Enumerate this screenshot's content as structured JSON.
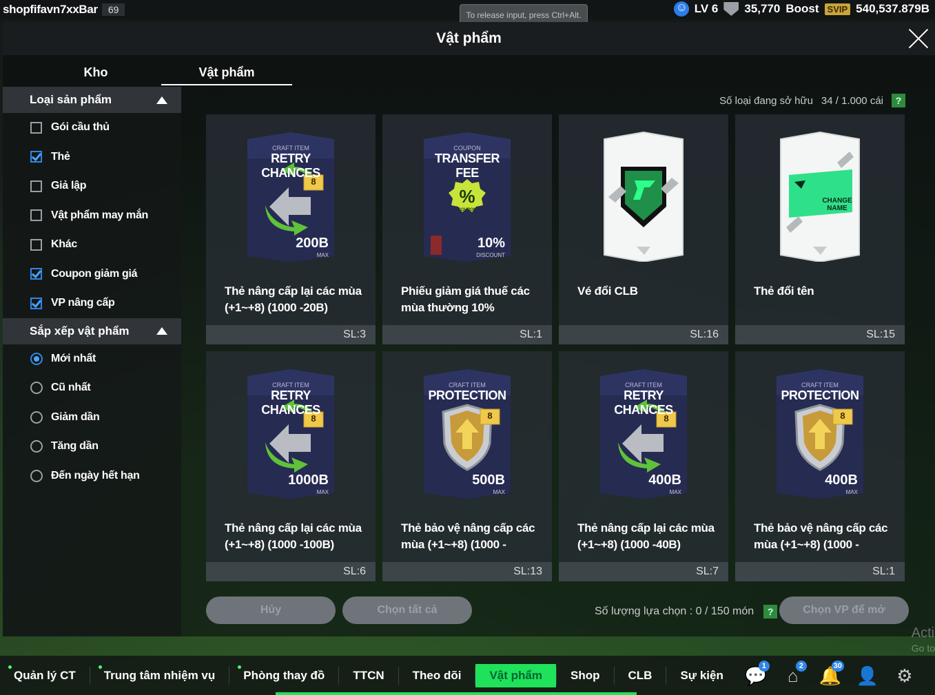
{
  "topbar": {
    "username": "shopfifavn7xxBar",
    "user_level": "69",
    "tooltip": "To release input, press Ctrl+Alt.",
    "lv": "LV 6",
    "points": "35,770",
    "boost": "Boost",
    "svip": "SVIP",
    "balance": "540,537.879B"
  },
  "window": {
    "title": "Vật phẩm"
  },
  "tabs": [
    {
      "label": "Kho"
    },
    {
      "label": "Vật phẩm"
    }
  ],
  "sidebar": {
    "category_header": "Loại sản phẩm",
    "categories": [
      {
        "label": "Gói cầu thủ",
        "checked": false
      },
      {
        "label": "Thẻ",
        "checked": true
      },
      {
        "label": "Giả lập",
        "checked": false
      },
      {
        "label": "Vật phẩm may mắn",
        "checked": false
      },
      {
        "label": "Khác",
        "checked": false
      },
      {
        "label": "Coupon giảm giá",
        "checked": true
      },
      {
        "label": "VP nâng cấp",
        "checked": true
      }
    ],
    "sort_header": "Sắp xếp vật phẩm",
    "sorts": [
      {
        "label": "Mới nhất",
        "selected": true
      },
      {
        "label": "Cũ nhất",
        "selected": false
      },
      {
        "label": "Giảm dần",
        "selected": false
      },
      {
        "label": "Tăng dần",
        "selected": false
      },
      {
        "label": "Đến ngày hết hạn",
        "selected": false
      }
    ]
  },
  "owned": {
    "label": "Số loại đang sở hữu",
    "value": "34 / 1.000 cái",
    "help": "?"
  },
  "items": [
    {
      "art": "retry",
      "top": "CRAFT ITEM",
      "title": "RETRY CHANCES",
      "badge": "8",
      "value": "200B",
      "sub": "MAX",
      "name": "Thẻ nâng cấp lại các mùa (+1~+8) (1000 -20B)",
      "qty": "SL:3"
    },
    {
      "art": "coupon",
      "top": "COUPON",
      "title": "TRANSFER FEE",
      "badge": "%",
      "badge_sub": "COUPON",
      "value": "10%",
      "sub": "DISCOUNT",
      "name": "Phiếu giảm giá thuế các mùa thường 10%",
      "qty": "SL:1"
    },
    {
      "art": "clb",
      "name": "Vé đổi CLB",
      "qty": "SL:16"
    },
    {
      "art": "rename",
      "card_text": "CHANGE NAME",
      "name": "Thẻ đổi tên",
      "qty": "SL:15"
    },
    {
      "art": "retry",
      "top": "CRAFT ITEM",
      "title": "RETRY CHANCES",
      "badge": "8",
      "value": "1000B",
      "sub": "MAX",
      "name": "Thẻ nâng cấp lại các mùa (+1~+8) (1000 -100B)",
      "qty": "SL:6"
    },
    {
      "art": "protect",
      "top": "CRAFT ITEM",
      "title": "PROTECTION",
      "badge": "8",
      "value": "500B",
      "sub": "MAX",
      "name": "Thẻ bảo vệ nâng cấp các mùa (+1~+8) (1000 -",
      "qty": "SL:13"
    },
    {
      "art": "retry",
      "top": "CRAFT ITEM",
      "title": "RETRY CHANCES",
      "badge": "8",
      "value": "400B",
      "sub": "MAX",
      "name": "Thẻ nâng cấp lại các mùa (+1~+8) (1000 -40B)",
      "qty": "SL:7"
    },
    {
      "art": "protect",
      "top": "CRAFT ITEM",
      "title": "PROTECTION",
      "badge": "8",
      "value": "400B",
      "sub": "MAX",
      "name": "Thẻ bảo vệ nâng cấp các mùa (+1~+8) (1000 -",
      "qty": "SL:1"
    }
  ],
  "actions": {
    "cancel": "Hủy",
    "select_all": "Chọn tất cả",
    "selection_label": "Số lượng lựa chọn : 0 / 150 món",
    "help": "?",
    "open": "Chọn VP để mở"
  },
  "watermark": {
    "line1": "Acti",
    "line2": "Go to"
  },
  "nav": {
    "items": [
      {
        "label": "Quản lý CT",
        "dot": true
      },
      {
        "label": "Trung tâm nhiệm vụ",
        "dot": true
      },
      {
        "label": "Phòng thay đồ",
        "dot": true
      },
      {
        "label": "TTCN",
        "dot": false
      },
      {
        "label": "Theo dõi",
        "dot": false
      },
      {
        "label": "Vật phẩm",
        "dot": false,
        "active": true
      },
      {
        "label": "Shop",
        "dot": false
      },
      {
        "label": "CLB",
        "dot": false
      },
      {
        "label": "Sự kiện",
        "dot": false
      }
    ],
    "icons": [
      {
        "name": "chat-icon",
        "badge": "1"
      },
      {
        "name": "home-icon",
        "badge": "2"
      },
      {
        "name": "bell-icon",
        "badge": "30"
      },
      {
        "name": "profile-icon",
        "badge": ""
      },
      {
        "name": "gear-icon",
        "badge": ""
      }
    ],
    "accent": "#1fe25a"
  }
}
